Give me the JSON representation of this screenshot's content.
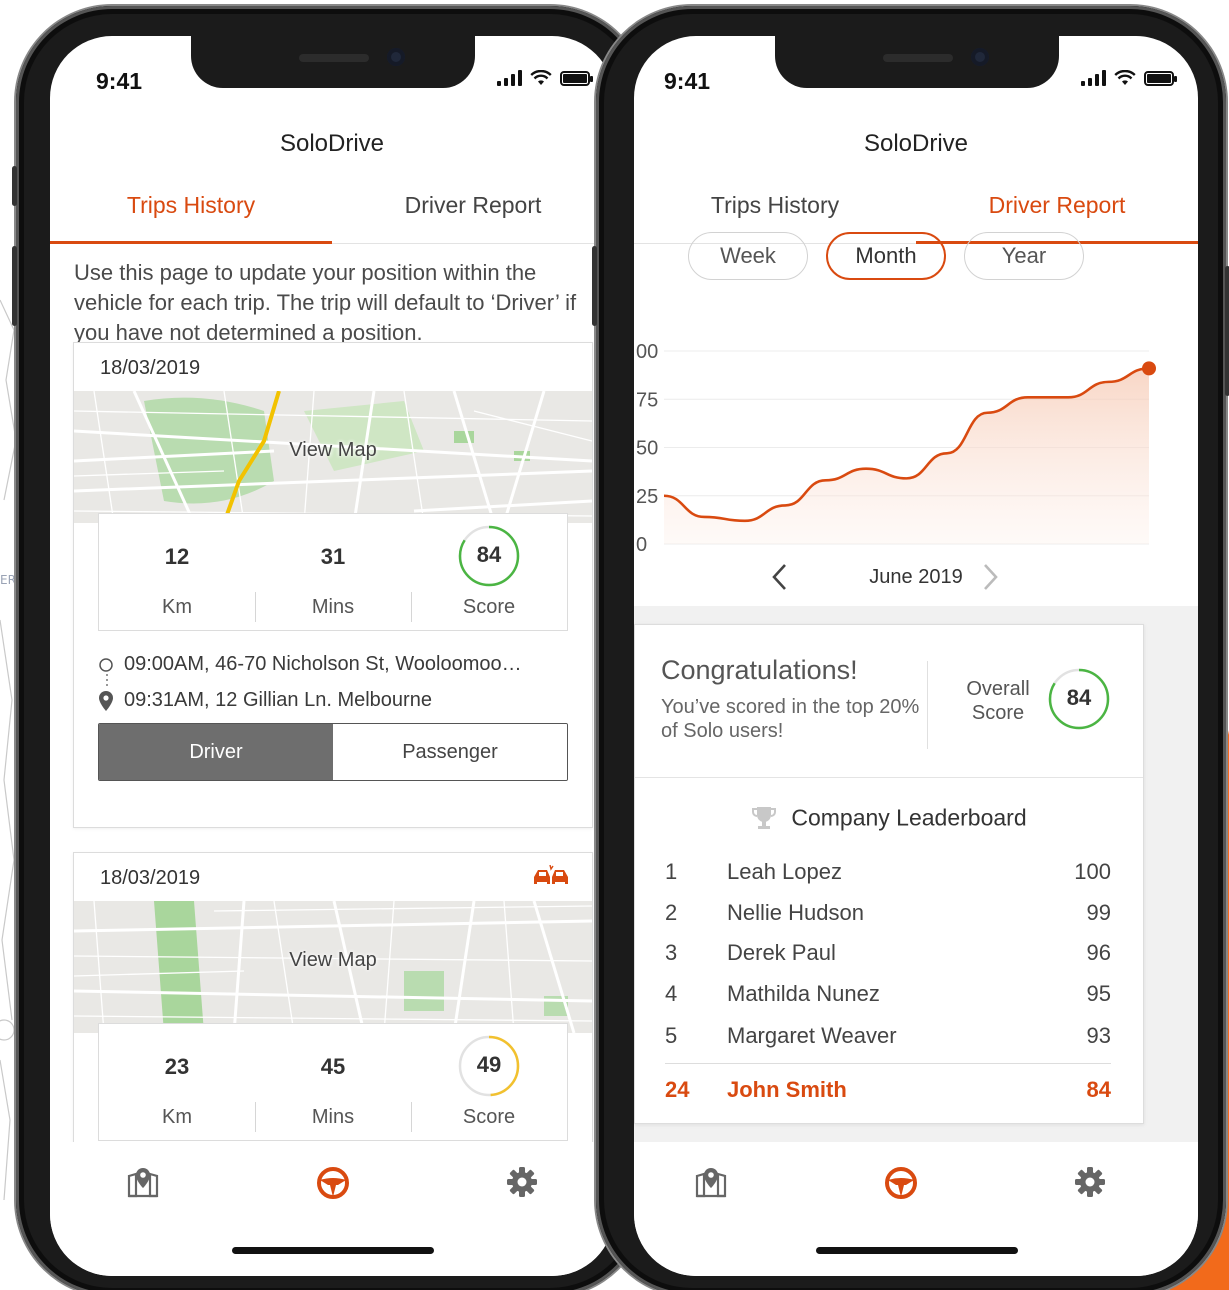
{
  "colors": {
    "accent": "#d94a10",
    "score_good": "#4bb543",
    "score_mid": "#f2c12e",
    "chart_line": "#d94a10"
  },
  "status": {
    "time": "9:41"
  },
  "app": {
    "title": "SoloDrive"
  },
  "tabs": {
    "trips": "Trips History",
    "report": "Driver Report"
  },
  "trips": {
    "intro": "Use this page to update your position within the vehicle for each trip. The trip will default to ‘Driver’ if you have not determined a position.",
    "view_map": "View Map",
    "items": [
      {
        "date": "18/03/2019",
        "km": "12",
        "km_label": "Km",
        "mins": "31",
        "mins_label": "Mins",
        "score": "84",
        "score_label": "Score",
        "score_fraction": 0.84,
        "start": "09:00AM, 46-70 Nicholson St, Wooloomoo…",
        "end": "09:31AM, 12 Gillian Ln. Melbourne",
        "driver_label": "Driver",
        "passenger_label": "Passenger",
        "selected": "Driver"
      },
      {
        "date": "18/03/2019",
        "incident_icon": "car-crash-icon",
        "km": "23",
        "km_label": "Km",
        "mins": "45",
        "mins_label": "Mins",
        "score": "49",
        "score_label": "Score",
        "score_fraction": 0.49
      }
    ]
  },
  "report": {
    "periods": [
      "Week",
      "Month",
      "Year"
    ],
    "selected_period": "Month",
    "month_label": "June 2019",
    "congrats_title": "Congratulations!",
    "congrats_sub": "You’ve scored in the top 20% of Solo users!",
    "overall_label": "Overall Score",
    "overall_score": "84",
    "overall_fraction": 0.84,
    "leaderboard_title": "Company Leaderboard",
    "leaderboard": [
      {
        "rank": "1",
        "name": "Leah Lopez",
        "score": "100"
      },
      {
        "rank": "2",
        "name": "Nellie Hudson",
        "score": "99"
      },
      {
        "rank": "3",
        "name": "Derek Paul",
        "score": "96"
      },
      {
        "rank": "4",
        "name": "Mathilda Nunez",
        "score": "95"
      },
      {
        "rank": "5",
        "name": "Margaret Weaver",
        "score": "93"
      }
    ],
    "me": {
      "rank": "24",
      "name": "John Smith",
      "score": "84"
    }
  },
  "chart_data": {
    "type": "line",
    "y_tick_labels": [
      "00",
      "75",
      "50",
      "25",
      "0"
    ],
    "ylim": [
      0,
      100
    ],
    "grid": true,
    "x": [
      0,
      1,
      2,
      3,
      4,
      5,
      6,
      7,
      8,
      9,
      10,
      11,
      12
    ],
    "series": [
      {
        "values": [
          25,
          14,
          12,
          20,
          33,
          39,
          34,
          47,
          68,
          76,
          76,
          84,
          91
        ]
      }
    ]
  },
  "nav_icons": [
    "map-pin-icon",
    "steering-wheel-icon",
    "gear-icon"
  ]
}
